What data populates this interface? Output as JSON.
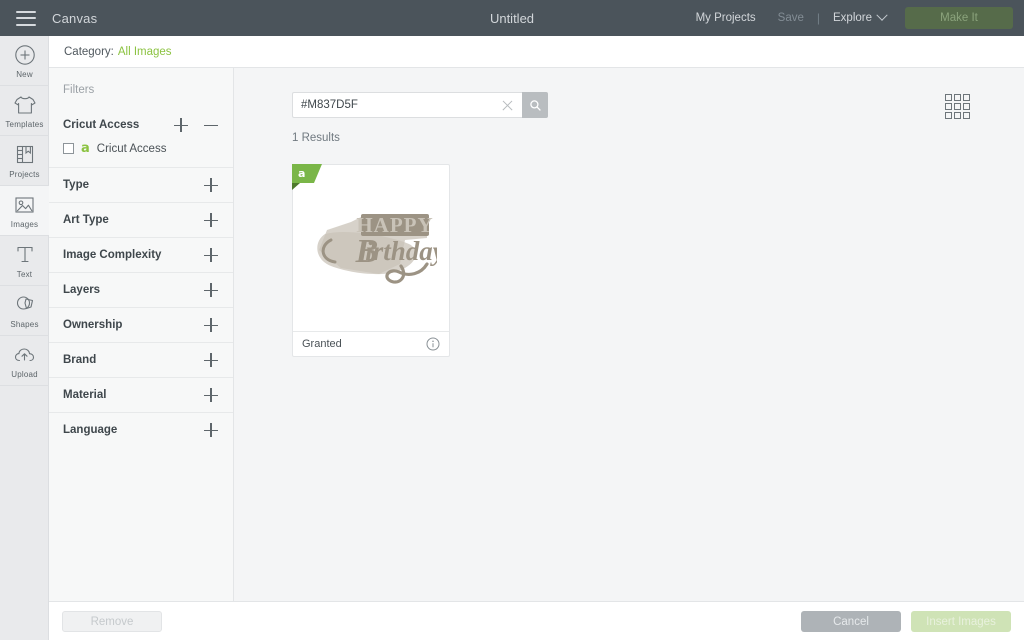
{
  "header": {
    "menu_icon": "hamburger-icon",
    "app_label": "Canvas",
    "project_title": "Untitled",
    "my_projects": "My Projects",
    "save": "Save",
    "separator": "|",
    "explore": "Explore",
    "make_it": "Make It",
    "bg_color": "#4b545b",
    "make_it_color": "#566b4a"
  },
  "sidebar": {
    "items": [
      {
        "label": "New",
        "icon": "plus-circle-icon",
        "active": false
      },
      {
        "label": "Templates",
        "icon": "tshirt-icon",
        "active": false
      },
      {
        "label": "Projects",
        "icon": "book-icon",
        "active": false
      },
      {
        "label": "Images",
        "icon": "image-icon",
        "active": true
      },
      {
        "label": "Text",
        "icon": "text-icon",
        "active": false
      },
      {
        "label": "Shapes",
        "icon": "shapes-icon",
        "active": false
      },
      {
        "label": "Upload",
        "icon": "cloud-upload-icon",
        "active": false
      }
    ]
  },
  "category_bar": {
    "label": "Category:",
    "value": "All Images",
    "link_color": "#8cc342"
  },
  "filters": {
    "title": "Filters",
    "groups": [
      {
        "name": "Cricut Access",
        "expanded": true,
        "option_label": "Cricut Access",
        "option_badge": "a",
        "checked": false
      },
      {
        "name": "Type",
        "expanded": false
      },
      {
        "name": "Art Type",
        "expanded": false
      },
      {
        "name": "Image Complexity",
        "expanded": false
      },
      {
        "name": "Layers",
        "expanded": false
      },
      {
        "name": "Ownership",
        "expanded": false
      },
      {
        "name": "Brand",
        "expanded": false
      },
      {
        "name": "Material",
        "expanded": false
      },
      {
        "name": "Language",
        "expanded": false
      }
    ]
  },
  "search": {
    "value": "#M837D5F",
    "placeholder": "Search",
    "clear_icon": "close-icon",
    "submit_icon": "search-icon"
  },
  "results": {
    "count_text": "1 Results",
    "view_toggle_icon": "grid-view-icon",
    "cards": [
      {
        "name": "Granted",
        "badge": "a",
        "badge_color": "#7ab648",
        "info_icon": "info-icon",
        "art_title": "HAPPY",
        "art_script": "Birthday",
        "art_color": "#9c9384",
        "art_shadow_color": "#c9c3b8"
      }
    ]
  },
  "footer": {
    "remove": "Remove",
    "cancel": "Cancel",
    "insert_images": "Insert Images"
  }
}
